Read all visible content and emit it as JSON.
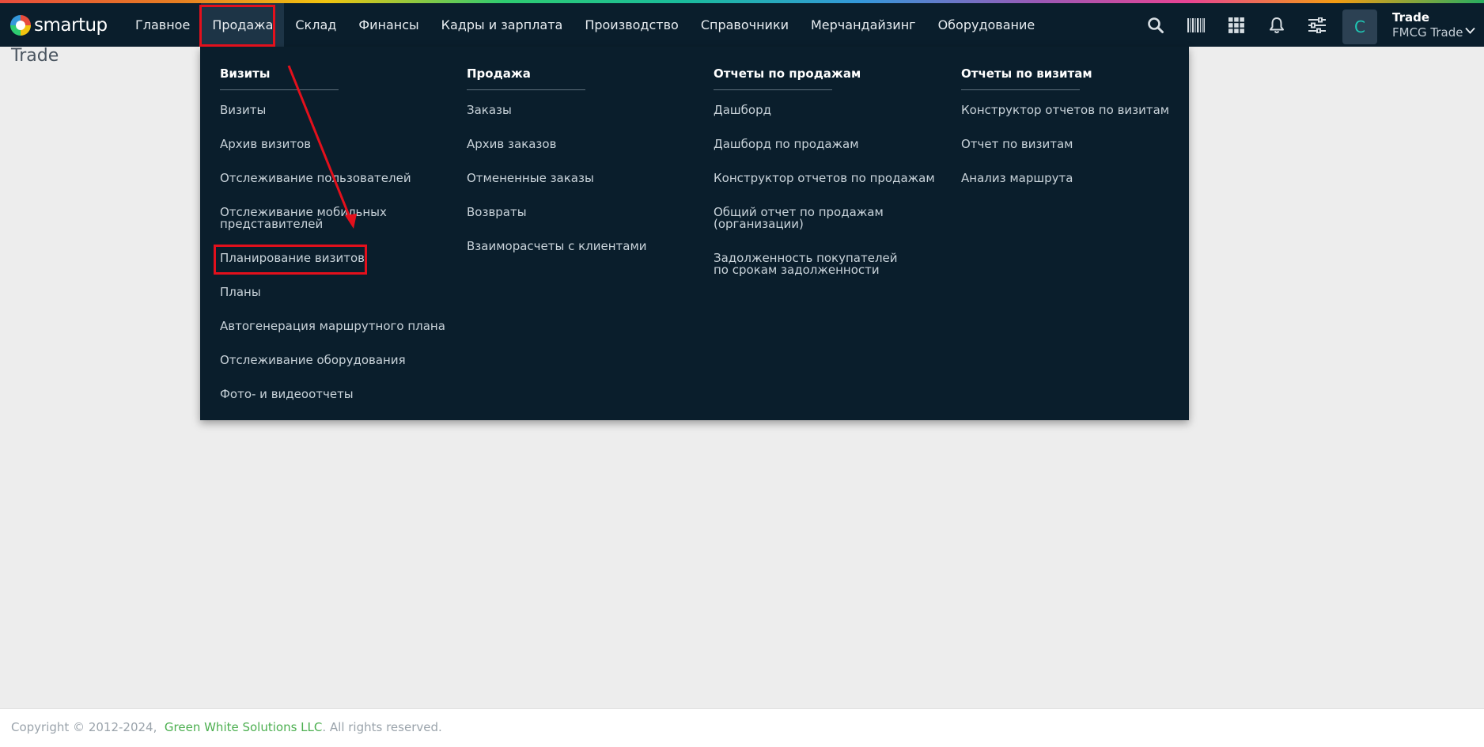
{
  "app": {
    "logo_text": "smartup"
  },
  "nav": {
    "items": [
      "Главное",
      "Продажа",
      "Склад",
      "Финансы",
      "Кадры и зарплата",
      "Производство",
      "Справочники",
      "Мерчандайзинг",
      "Оборудование"
    ],
    "active": "Продажа"
  },
  "header_icons": [
    "search-icon",
    "barcode-icon",
    "apps-grid-icon",
    "bell-icon",
    "settings-sliders-icon"
  ],
  "user": {
    "avatar_letter": "С"
  },
  "company": {
    "name": "Trade",
    "subtitle": "FMCG Trade"
  },
  "page": {
    "title": "Trade"
  },
  "dropdown": {
    "columns": [
      {
        "heading": "Визиты",
        "items": [
          "Визиты",
          "Архив визитов",
          "Отслеживание пользователей",
          "Отслеживание мобильных представителей",
          "Планирование визитов",
          "Планы",
          "Автогенерация маршрутного плана",
          "Отслеживание оборудования",
          "Фото- и видеоотчеты"
        ]
      },
      {
        "heading": "Продажа",
        "items": [
          "Заказы",
          "Архив заказов",
          "Отмененные заказы",
          "Возвраты",
          "Взаиморасчеты с клиентами"
        ]
      },
      {
        "heading": "Отчеты по продажам",
        "items": [
          "Дашборд",
          "Дашборд по продажам",
          "Конструктор отчетов по продажам",
          "Общий отчет по продажам (организации)",
          "Задолженность покупателей по срокам задолженности"
        ]
      },
      {
        "heading": "Отчеты по визитам",
        "items": [
          "Конструктор отчетов по визитам",
          "Отчет по визитам",
          "Анализ маршрута"
        ]
      }
    ],
    "highlighted_item": "Планирование визитов"
  },
  "footer": {
    "copyright": "Copyright © 2012-2024,",
    "company_link": "Green White Solutions LLC",
    "rights": ". All rights reserved."
  },
  "colors": {
    "topbar": "#0a1e2c",
    "highlight": "#e3101c",
    "accent": "#1fc7b4",
    "link": "#4caf50"
  }
}
